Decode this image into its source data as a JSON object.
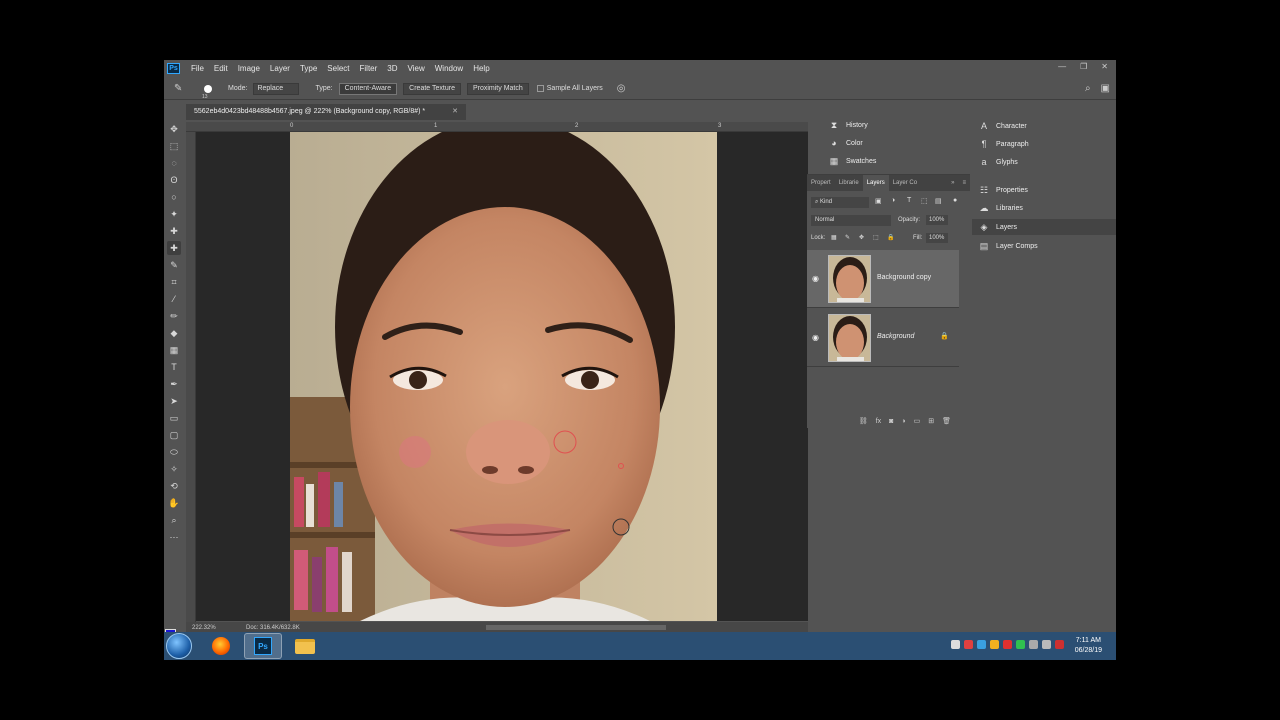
{
  "menu": {
    "items": [
      "File",
      "Edit",
      "Image",
      "Layer",
      "Type",
      "Select",
      "Filter",
      "3D",
      "View",
      "Window",
      "Help"
    ],
    "window_controls": [
      "—",
      "❐",
      "✕"
    ]
  },
  "options": {
    "brush_size": "13",
    "mode_label": "Mode:",
    "mode_value": "Replace",
    "type_label": "Type:",
    "type_buttons": [
      "Content-Aware",
      "Create Texture",
      "Proximity Match"
    ],
    "sample_all_layers": "Sample All Layers"
  },
  "document": {
    "tab_title": "5562eb4d0423bd48488b4567.jpeg @ 222% (Background copy, RGB/8#) *",
    "zoom": "222.32%",
    "doc_size": "Doc: 316.4K/632.8K",
    "ruler_ticks": [
      "0",
      "1",
      "2",
      "3"
    ]
  },
  "dock_a": {
    "items": [
      {
        "label": "History",
        "icon": "history-icon"
      },
      {
        "label": "Color",
        "icon": "color-icon"
      },
      {
        "label": "Swatches",
        "icon": "swatches-icon"
      }
    ]
  },
  "dock_b": {
    "items": [
      {
        "label": "Character",
        "icon": "character-icon"
      },
      {
        "label": "Paragraph",
        "icon": "paragraph-icon"
      },
      {
        "label": "Glyphs",
        "icon": "glyphs-icon"
      },
      {
        "label": "Properties",
        "icon": "properties-icon"
      },
      {
        "label": "Libraries",
        "icon": "libraries-icon"
      },
      {
        "label": "Layers",
        "icon": "layers-icon"
      },
      {
        "label": "Layer Comps",
        "icon": "layer-comps-icon"
      }
    ]
  },
  "layers_panel": {
    "tabs": [
      "Propert",
      "Librarie",
      "Layers",
      "Layer Co"
    ],
    "filter": "Kind",
    "blend_mode": "Normal",
    "opacity_label": "Opacity:",
    "opacity": "100%",
    "lock_label": "Lock:",
    "fill_label": "Fill:",
    "fill": "100%",
    "layers": [
      {
        "name": "Background copy",
        "selected": true,
        "locked": false
      },
      {
        "name": "Background",
        "selected": false,
        "locked": true
      }
    ]
  },
  "taskbar": {
    "time": "7:11 AM",
    "date": "06/28/19"
  },
  "colors": {
    "foreground": "#1a17d6",
    "background": "#e51b24",
    "accent": "#31a8ff"
  }
}
